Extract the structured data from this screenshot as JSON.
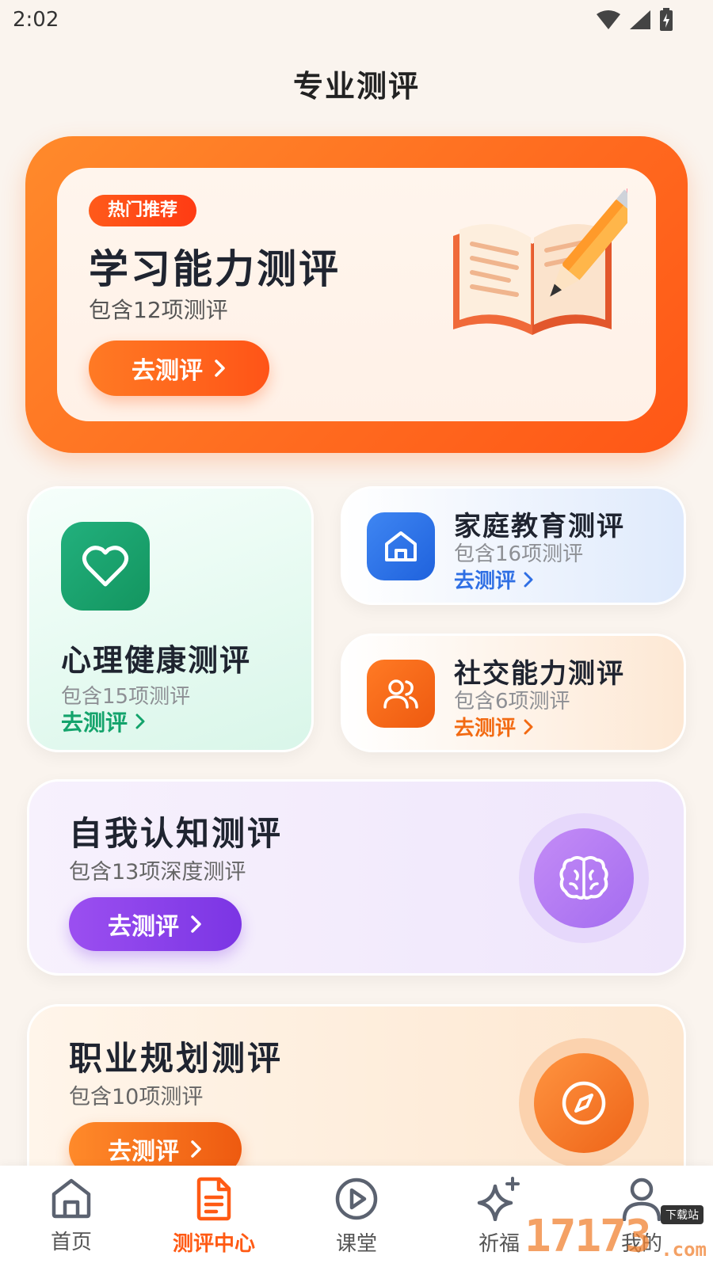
{
  "status": {
    "time": "2:02"
  },
  "page_title": "专业测评",
  "hero": {
    "badge": "热门推荐",
    "title": "学习能力测评",
    "subtitle": "包含12项测评",
    "button": "去测评"
  },
  "cards": {
    "mental": {
      "title": "心理健康测评",
      "subtitle": "包含15项测评",
      "link": "去测评",
      "color": "#13a36b"
    },
    "family": {
      "title": "家庭教育测评",
      "subtitle": "包含16项测评",
      "link": "去测评",
      "color": "#2f6fe4"
    },
    "social": {
      "title": "社交能力测评",
      "subtitle": "包含6项测评",
      "link": "去测评",
      "color": "#f26a12"
    },
    "self": {
      "title": "自我认知测评",
      "subtitle": "包含13项深度测评",
      "button": "去测评",
      "color": "#8b3fe8"
    },
    "career": {
      "title": "职业规划测评",
      "subtitle": "包含10项测评",
      "button": "去测评",
      "color": "#f26a12"
    }
  },
  "tabs": [
    {
      "label": "首页",
      "icon": "home-icon",
      "active": false
    },
    {
      "label": "测评中心",
      "icon": "document-icon",
      "active": true
    },
    {
      "label": "课堂",
      "icon": "play-icon",
      "active": false
    },
    {
      "label": "祈福",
      "icon": "sparkle-icon",
      "active": false
    },
    {
      "label": "我的",
      "icon": "user-icon",
      "active": false
    }
  ],
  "watermark": {
    "text": "17173",
    "tag": "下载站",
    "suffix": ".com"
  }
}
